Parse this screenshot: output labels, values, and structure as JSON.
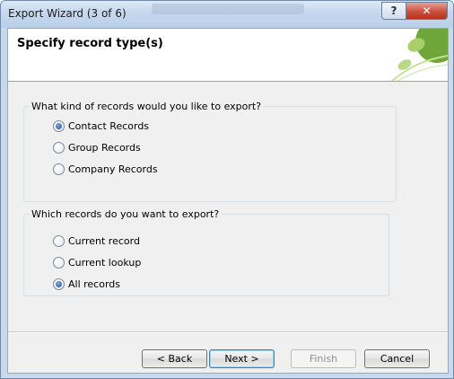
{
  "window": {
    "title": "Export Wizard (3 of 6)"
  },
  "titlebar": {
    "help_label": "?",
    "close_label": "✕"
  },
  "header": {
    "title": "Specify record type(s)"
  },
  "record_kind_group": {
    "legend": "What kind of records would you like to export?",
    "options": [
      {
        "label": "Contact Records",
        "selected": true
      },
      {
        "label": "Group Records",
        "selected": false
      },
      {
        "label": "Company Records",
        "selected": false
      }
    ]
  },
  "record_scope_group": {
    "legend": "Which records do you want to export?",
    "options": [
      {
        "label": "Current record",
        "selected": false
      },
      {
        "label": "Current lookup",
        "selected": false
      },
      {
        "label": "All records",
        "selected": true
      }
    ]
  },
  "buttons": {
    "back": "< Back",
    "next": "Next >",
    "finish": "Finish",
    "cancel": "Cancel"
  },
  "colors": {
    "leaf_dark": "#6fa63a",
    "leaf_light": "#a8cf6a",
    "close_red": "#c9503b"
  }
}
